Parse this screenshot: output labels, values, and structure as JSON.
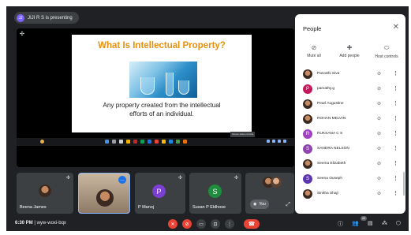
{
  "presenting": {
    "initials": "JJ",
    "label": "JIJI R S is presenting"
  },
  "slide": {
    "title": "What Is Intellectual Property?",
    "body_line1": "Any property created from the intellectual",
    "body_line2": "efforts of an individual."
  },
  "tooltip": "Screen share controls",
  "participants": [
    {
      "name": "Beena James"
    },
    {
      "name": "",
      "self_badge": "…"
    },
    {
      "name": "P Manoj",
      "initial": "P",
      "color": "#7b3fd1"
    },
    {
      "name": "Susan P Eldhose",
      "initial": "S",
      "color": "#1e8e3e"
    },
    {
      "you_label": "You"
    }
  ],
  "meeting": {
    "time": "6:30 PM",
    "separator": "|",
    "code": "wyw-woxi-bqx"
  },
  "people_panel": {
    "title": "People",
    "actions": [
      {
        "label": "Mute all",
        "icon": "mic-off-icon"
      },
      {
        "label": "Add people",
        "icon": "add-person-icon"
      },
      {
        "label": "Host controls",
        "icon": "lock-icon"
      }
    ],
    "people": [
      {
        "name": "Parvathi Siva",
        "avatar": "photo"
      },
      {
        "name": "parvathy.g",
        "avatar": "initial",
        "initial": "P",
        "color": "#c2185b"
      },
      {
        "name": "Pearl Augustine",
        "avatar": "photo"
      },
      {
        "name": "ROHAN MELVIN",
        "avatar": "photo"
      },
      {
        "name": "RUKSANA C S",
        "avatar": "initial",
        "initial": "R",
        "color": "#a142c4"
      },
      {
        "name": "SANDRA NELSON",
        "avatar": "initial",
        "initial": "S",
        "color": "#8e44ad"
      },
      {
        "name": "Seema Elizabeth",
        "avatar": "photo"
      },
      {
        "name": "Seena Ouseph",
        "avatar": "initial",
        "initial": "S",
        "color": "#5e35b1"
      },
      {
        "name": "Sinitha Shaji",
        "avatar": "photo"
      }
    ]
  },
  "participant_count": "42",
  "colors": {
    "accent": "#1a73e8",
    "danger": "#ea4335",
    "background": "#202124"
  }
}
